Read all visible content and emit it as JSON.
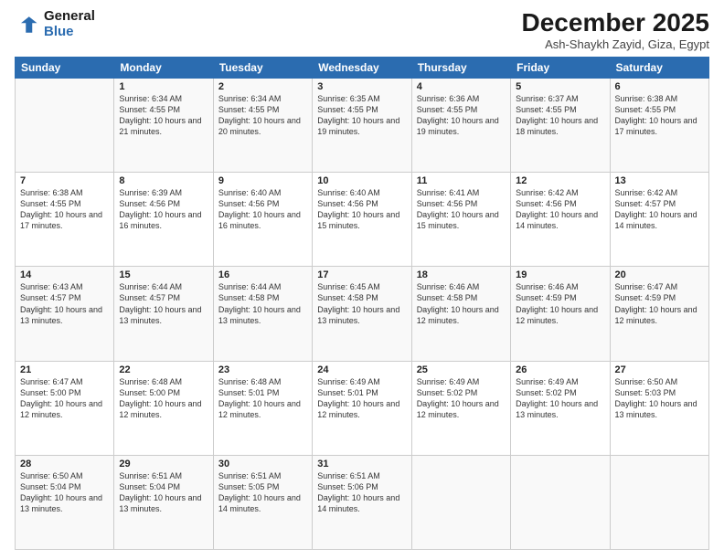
{
  "header": {
    "logo_line1": "General",
    "logo_line2": "Blue",
    "month_title": "December 2025",
    "location": "Ash-Shaykh Zayid, Giza, Egypt"
  },
  "days_of_week": [
    "Sunday",
    "Monday",
    "Tuesday",
    "Wednesday",
    "Thursday",
    "Friday",
    "Saturday"
  ],
  "weeks": [
    [
      {
        "day": "",
        "sunrise": "",
        "sunset": "",
        "daylight": ""
      },
      {
        "day": "1",
        "sunrise": "Sunrise: 6:34 AM",
        "sunset": "Sunset: 4:55 PM",
        "daylight": "Daylight: 10 hours and 21 minutes."
      },
      {
        "day": "2",
        "sunrise": "Sunrise: 6:34 AM",
        "sunset": "Sunset: 4:55 PM",
        "daylight": "Daylight: 10 hours and 20 minutes."
      },
      {
        "day": "3",
        "sunrise": "Sunrise: 6:35 AM",
        "sunset": "Sunset: 4:55 PM",
        "daylight": "Daylight: 10 hours and 19 minutes."
      },
      {
        "day": "4",
        "sunrise": "Sunrise: 6:36 AM",
        "sunset": "Sunset: 4:55 PM",
        "daylight": "Daylight: 10 hours and 19 minutes."
      },
      {
        "day": "5",
        "sunrise": "Sunrise: 6:37 AM",
        "sunset": "Sunset: 4:55 PM",
        "daylight": "Daylight: 10 hours and 18 minutes."
      },
      {
        "day": "6",
        "sunrise": "Sunrise: 6:38 AM",
        "sunset": "Sunset: 4:55 PM",
        "daylight": "Daylight: 10 hours and 17 minutes."
      }
    ],
    [
      {
        "day": "7",
        "sunrise": "Sunrise: 6:38 AM",
        "sunset": "Sunset: 4:55 PM",
        "daylight": "Daylight: 10 hours and 17 minutes."
      },
      {
        "day": "8",
        "sunrise": "Sunrise: 6:39 AM",
        "sunset": "Sunset: 4:56 PM",
        "daylight": "Daylight: 10 hours and 16 minutes."
      },
      {
        "day": "9",
        "sunrise": "Sunrise: 6:40 AM",
        "sunset": "Sunset: 4:56 PM",
        "daylight": "Daylight: 10 hours and 16 minutes."
      },
      {
        "day": "10",
        "sunrise": "Sunrise: 6:40 AM",
        "sunset": "Sunset: 4:56 PM",
        "daylight": "Daylight: 10 hours and 15 minutes."
      },
      {
        "day": "11",
        "sunrise": "Sunrise: 6:41 AM",
        "sunset": "Sunset: 4:56 PM",
        "daylight": "Daylight: 10 hours and 15 minutes."
      },
      {
        "day": "12",
        "sunrise": "Sunrise: 6:42 AM",
        "sunset": "Sunset: 4:56 PM",
        "daylight": "Daylight: 10 hours and 14 minutes."
      },
      {
        "day": "13",
        "sunrise": "Sunrise: 6:42 AM",
        "sunset": "Sunset: 4:57 PM",
        "daylight": "Daylight: 10 hours and 14 minutes."
      }
    ],
    [
      {
        "day": "14",
        "sunrise": "Sunrise: 6:43 AM",
        "sunset": "Sunset: 4:57 PM",
        "daylight": "Daylight: 10 hours and 13 minutes."
      },
      {
        "day": "15",
        "sunrise": "Sunrise: 6:44 AM",
        "sunset": "Sunset: 4:57 PM",
        "daylight": "Daylight: 10 hours and 13 minutes."
      },
      {
        "day": "16",
        "sunrise": "Sunrise: 6:44 AM",
        "sunset": "Sunset: 4:58 PM",
        "daylight": "Daylight: 10 hours and 13 minutes."
      },
      {
        "day": "17",
        "sunrise": "Sunrise: 6:45 AM",
        "sunset": "Sunset: 4:58 PM",
        "daylight": "Daylight: 10 hours and 13 minutes."
      },
      {
        "day": "18",
        "sunrise": "Sunrise: 6:46 AM",
        "sunset": "Sunset: 4:58 PM",
        "daylight": "Daylight: 10 hours and 12 minutes."
      },
      {
        "day": "19",
        "sunrise": "Sunrise: 6:46 AM",
        "sunset": "Sunset: 4:59 PM",
        "daylight": "Daylight: 10 hours and 12 minutes."
      },
      {
        "day": "20",
        "sunrise": "Sunrise: 6:47 AM",
        "sunset": "Sunset: 4:59 PM",
        "daylight": "Daylight: 10 hours and 12 minutes."
      }
    ],
    [
      {
        "day": "21",
        "sunrise": "Sunrise: 6:47 AM",
        "sunset": "Sunset: 5:00 PM",
        "daylight": "Daylight: 10 hours and 12 minutes."
      },
      {
        "day": "22",
        "sunrise": "Sunrise: 6:48 AM",
        "sunset": "Sunset: 5:00 PM",
        "daylight": "Daylight: 10 hours and 12 minutes."
      },
      {
        "day": "23",
        "sunrise": "Sunrise: 6:48 AM",
        "sunset": "Sunset: 5:01 PM",
        "daylight": "Daylight: 10 hours and 12 minutes."
      },
      {
        "day": "24",
        "sunrise": "Sunrise: 6:49 AM",
        "sunset": "Sunset: 5:01 PM",
        "daylight": "Daylight: 10 hours and 12 minutes."
      },
      {
        "day": "25",
        "sunrise": "Sunrise: 6:49 AM",
        "sunset": "Sunset: 5:02 PM",
        "daylight": "Daylight: 10 hours and 12 minutes."
      },
      {
        "day": "26",
        "sunrise": "Sunrise: 6:49 AM",
        "sunset": "Sunset: 5:02 PM",
        "daylight": "Daylight: 10 hours and 13 minutes."
      },
      {
        "day": "27",
        "sunrise": "Sunrise: 6:50 AM",
        "sunset": "Sunset: 5:03 PM",
        "daylight": "Daylight: 10 hours and 13 minutes."
      }
    ],
    [
      {
        "day": "28",
        "sunrise": "Sunrise: 6:50 AM",
        "sunset": "Sunset: 5:04 PM",
        "daylight": "Daylight: 10 hours and 13 minutes."
      },
      {
        "day": "29",
        "sunrise": "Sunrise: 6:51 AM",
        "sunset": "Sunset: 5:04 PM",
        "daylight": "Daylight: 10 hours and 13 minutes."
      },
      {
        "day": "30",
        "sunrise": "Sunrise: 6:51 AM",
        "sunset": "Sunset: 5:05 PM",
        "daylight": "Daylight: 10 hours and 14 minutes."
      },
      {
        "day": "31",
        "sunrise": "Sunrise: 6:51 AM",
        "sunset": "Sunset: 5:06 PM",
        "daylight": "Daylight: 10 hours and 14 minutes."
      },
      {
        "day": "",
        "sunrise": "",
        "sunset": "",
        "daylight": ""
      },
      {
        "day": "",
        "sunrise": "",
        "sunset": "",
        "daylight": ""
      },
      {
        "day": "",
        "sunrise": "",
        "sunset": "",
        "daylight": ""
      }
    ]
  ]
}
